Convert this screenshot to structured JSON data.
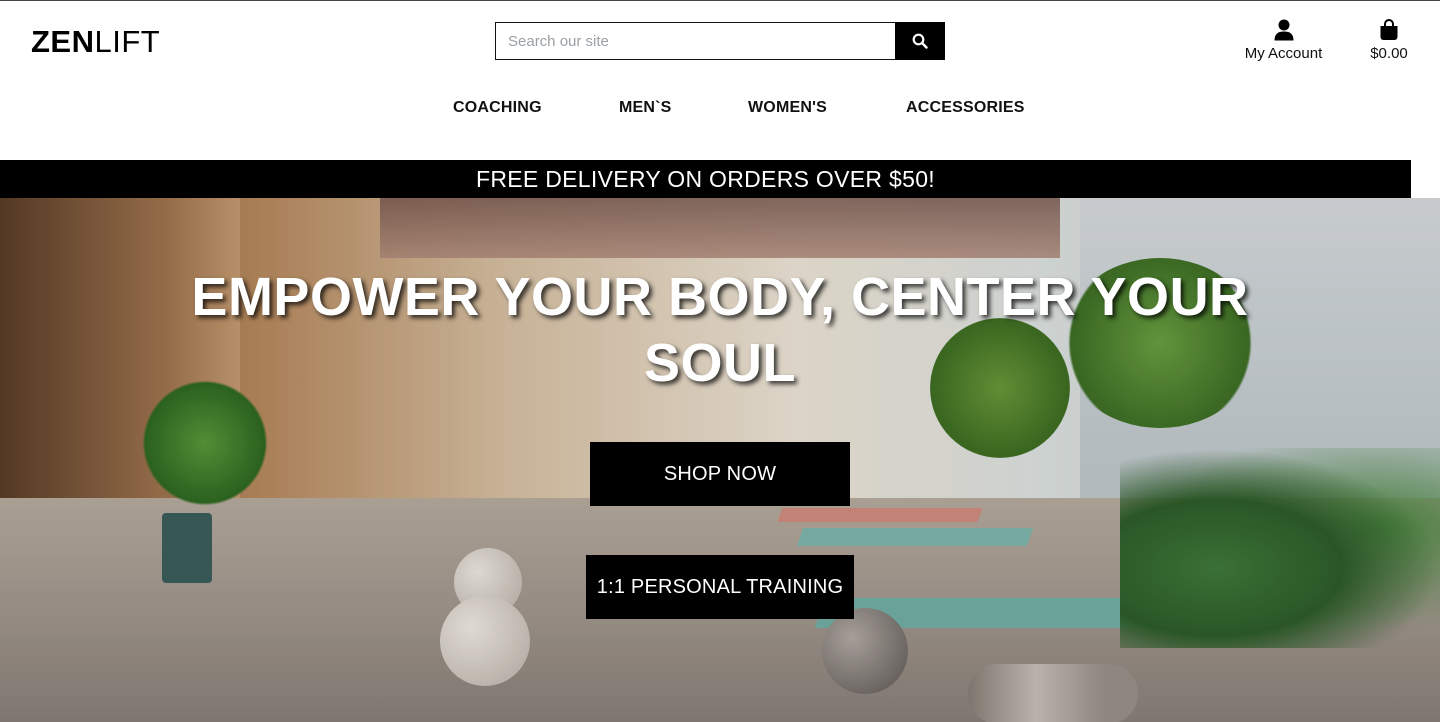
{
  "header": {
    "logo_bold": "ZEN",
    "logo_light": "LIFT",
    "search": {
      "placeholder": "Search our site",
      "value": ""
    },
    "account_label": "My Account",
    "cart_total": "$0.00"
  },
  "icons": {
    "search": "search-icon",
    "account": "user-icon",
    "cart": "shopping-bag-icon"
  },
  "nav": {
    "items": [
      {
        "label": "COACHING"
      },
      {
        "label": "MEN`S"
      },
      {
        "label": "WOMEN'S"
      },
      {
        "label": "ACCESSORIES"
      }
    ]
  },
  "banner": {
    "text": "FREE DELIVERY ON ORDERS OVER $50!"
  },
  "hero": {
    "headline": "EMPOWER YOUR BODY, CENTER YOUR SOUL",
    "shop_button": "SHOP NOW",
    "training_button": "1:1 PERSONAL TRAINING"
  },
  "colors": {
    "primary": "#000000",
    "background": "#ffffff",
    "text": "#111111",
    "placeholder": "#9aa0a6"
  }
}
